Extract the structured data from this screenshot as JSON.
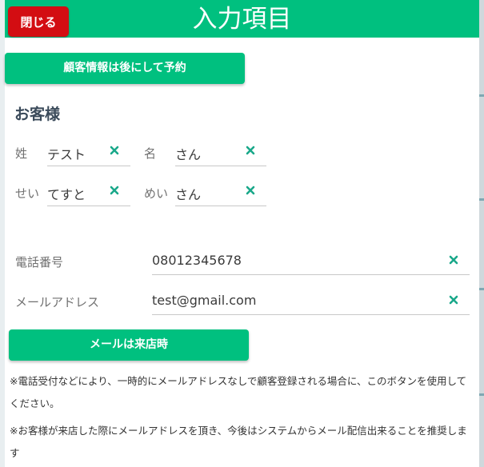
{
  "header": {
    "title": "入力項目",
    "close_label": "閉じる"
  },
  "buttons": {
    "reserve_later": "顧客情報は後にして予約",
    "mail_on_visit": "メールは来店時"
  },
  "customer": {
    "section_title": "お客様",
    "last_name": {
      "label": "姓",
      "value": "テスト"
    },
    "first_name": {
      "label": "名",
      "value": "さん"
    },
    "last_name_kana": {
      "label": "せい",
      "value": "てすと"
    },
    "first_name_kana": {
      "label": "めい",
      "value": "さん"
    },
    "phone": {
      "label": "電話番号",
      "value": "08012345678"
    },
    "email": {
      "label": "メールアドレス",
      "value": "test@gmail.com"
    }
  },
  "notes": {
    "note1": "※電話受付などにより、一時的にメールアドレスなしで顧客登録される場合に、このボタンを使用してください。",
    "note2": "※お客様が来店した際にメールアドレスを頂き、今後はシステムからメール配信出来ることを推奨します"
  },
  "colors": {
    "accent": "#00c07f",
    "close": "#d30d12",
    "clear_icon": "#1aa88a"
  },
  "icons": {
    "clear": "close-x-icon"
  }
}
